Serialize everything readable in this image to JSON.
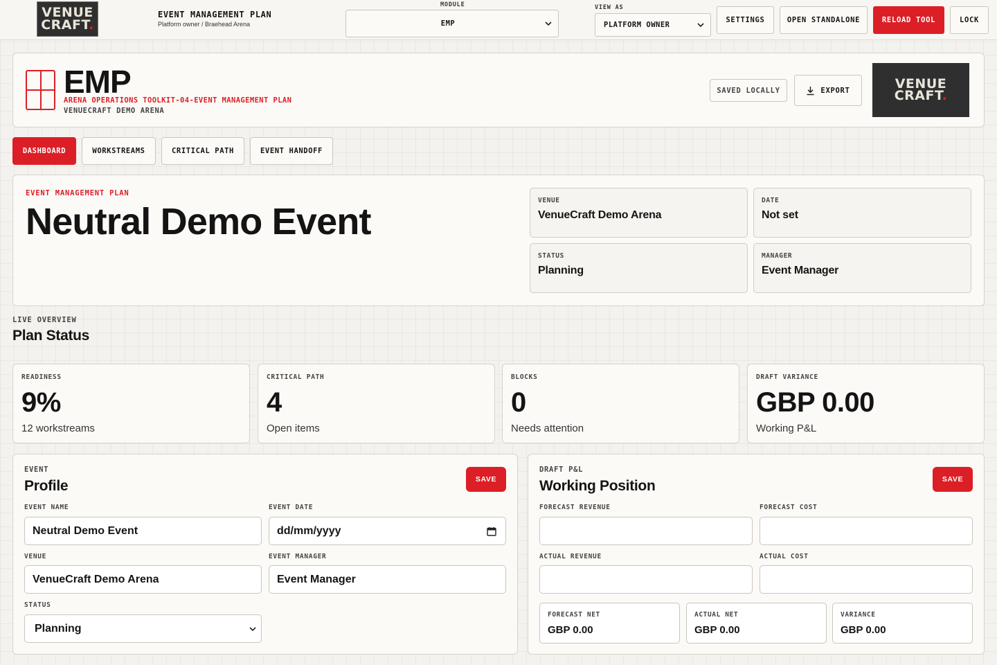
{
  "topbar": {
    "logo_line1": "VENUE",
    "logo_line2": "CRAFT",
    "logo_dot": ".",
    "title": "EVENT MANAGEMENT PLAN",
    "subtitle": "Platform owner / Braehead Arena",
    "module_label": "MODULE",
    "module_value": "EMP",
    "view_as_label": "VIEW AS",
    "view_as_value": "PLATFORM OWNER",
    "buttons": {
      "settings": "SETTINGS",
      "open_standalone": "OPEN STANDALONE",
      "reload_tool": "RELOAD TOOL",
      "lock": "LOCK"
    }
  },
  "header": {
    "title": "EMP",
    "subtitle": "ARENA OPERATIONS TOOLKIT-04-EVENT MANAGEMENT PLAN",
    "venue": "VENUECRAFT DEMO ARENA",
    "saved_status": "SAVED LOCALLY",
    "export_label": "EXPORT"
  },
  "tabs": [
    {
      "label": "DASHBOARD",
      "active": true
    },
    {
      "label": "WORKSTREAMS",
      "active": false
    },
    {
      "label": "CRITICAL PATH",
      "active": false
    },
    {
      "label": "EVENT HANDOFF",
      "active": false
    }
  ],
  "hero": {
    "kicker": "EVENT MANAGEMENT PLAN",
    "title": "Neutral Demo Event",
    "info": [
      {
        "label": "VENUE",
        "value": "VenueCraft Demo Arena"
      },
      {
        "label": "DATE",
        "value": "Not set"
      },
      {
        "label": "STATUS",
        "value": "Planning"
      },
      {
        "label": "MANAGER",
        "value": "Event Manager"
      }
    ]
  },
  "overview": {
    "kicker": "LIVE OVERVIEW",
    "title": "Plan Status",
    "stats": [
      {
        "label": "READINESS",
        "value": "9%",
        "sub": "12 workstreams"
      },
      {
        "label": "CRITICAL PATH",
        "value": "4",
        "sub": "Open items"
      },
      {
        "label": "BLOCKS",
        "value": "0",
        "sub": "Needs attention"
      },
      {
        "label": "DRAFT VARIANCE",
        "value": "GBP 0.00",
        "sub": "Working P&L"
      }
    ]
  },
  "profile": {
    "kicker": "EVENT",
    "title": "Profile",
    "save_label": "SAVE",
    "fields": {
      "event_name": {
        "label": "EVENT NAME",
        "value": "Neutral Demo Event"
      },
      "event_date": {
        "label": "EVENT DATE",
        "placeholder": "dd/mm/yyyy"
      },
      "venue": {
        "label": "VENUE",
        "value": "VenueCraft Demo Arena"
      },
      "event_manager": {
        "label": "EVENT MANAGER",
        "value": "Event Manager"
      },
      "status": {
        "label": "STATUS",
        "value": "Planning"
      }
    }
  },
  "pl": {
    "kicker": "DRAFT P&L",
    "title": "Working Position",
    "save_label": "SAVE",
    "fields": {
      "forecast_revenue": {
        "label": "FORECAST REVENUE",
        "value": ""
      },
      "forecast_cost": {
        "label": "FORECAST COST",
        "value": ""
      },
      "actual_revenue": {
        "label": "ACTUAL REVENUE",
        "value": ""
      },
      "actual_cost": {
        "label": "ACTUAL COST",
        "value": ""
      }
    },
    "outputs": [
      {
        "label": "FORECAST NET",
        "value": "GBP 0.00"
      },
      {
        "label": "ACTUAL NET",
        "value": "GBP 0.00"
      },
      {
        "label": "VARIANCE",
        "value": "GBP 0.00"
      }
    ]
  },
  "icons": {
    "chevron": "chevron-down-icon",
    "download": "download-icon",
    "calendar": "calendar-icon",
    "brand_grid": "grid-logo-icon"
  },
  "colors": {
    "accent": "#dc1f26",
    "logo_bg": "#2f2f2f",
    "background": "#f3f2ee"
  }
}
